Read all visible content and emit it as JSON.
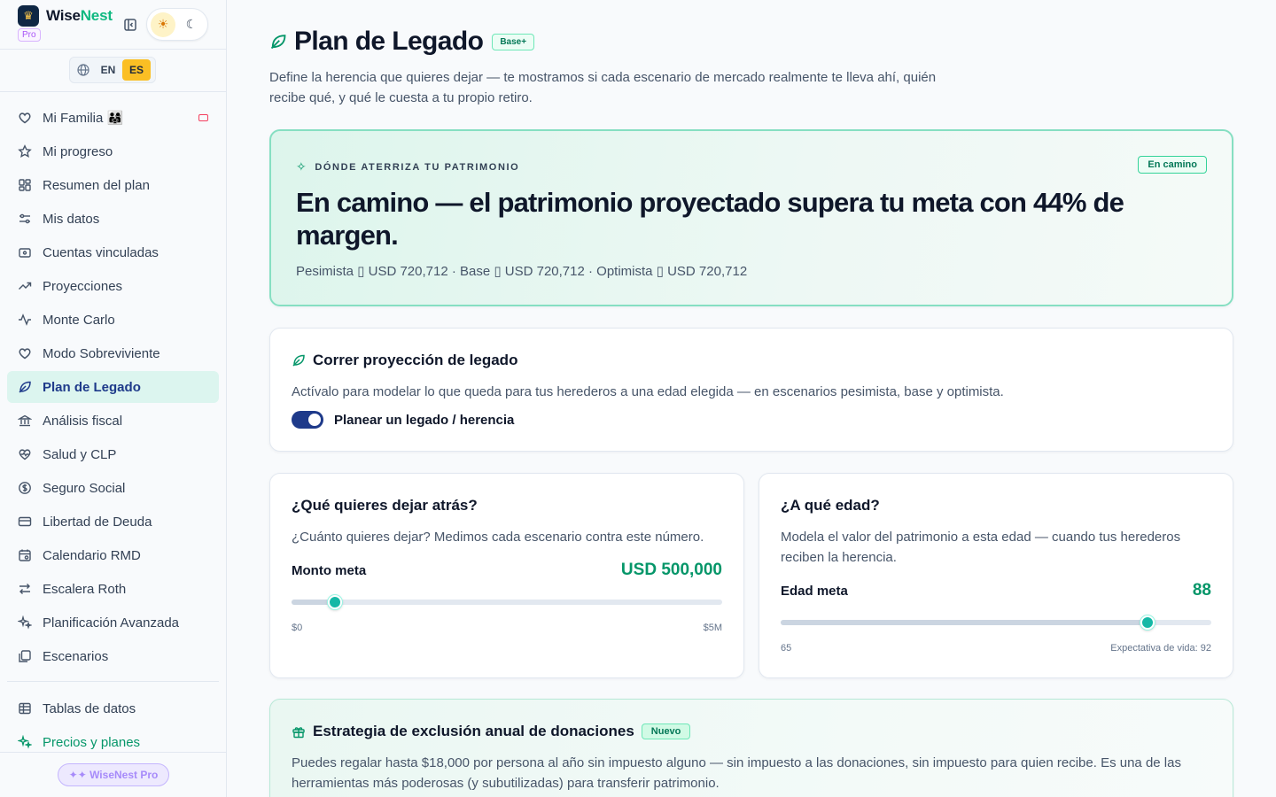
{
  "brand": {
    "name_part1": "Wise",
    "name_part2": "Nest",
    "tier": "Pro"
  },
  "language": {
    "options": [
      "EN",
      "ES"
    ],
    "active": "ES"
  },
  "sidebar": {
    "items": [
      {
        "label": "Mi Familia 👨‍👩‍👧",
        "icon": "heart-icon"
      },
      {
        "label": "Mi progreso",
        "icon": "star-icon"
      },
      {
        "label": "Resumen del plan",
        "icon": "grid-icon"
      },
      {
        "label": "Mis datos",
        "icon": "sliders-icon"
      },
      {
        "label": "Cuentas vinculadas",
        "icon": "wallet-icon"
      },
      {
        "label": "Proyecciones",
        "icon": "trend-icon"
      },
      {
        "label": "Monte Carlo",
        "icon": "pulse-icon"
      },
      {
        "label": "Modo Sobreviviente",
        "icon": "heart-icon"
      },
      {
        "label": "Plan de Legado",
        "icon": "leaf-icon"
      },
      {
        "label": "Análisis fiscal",
        "icon": "bank-icon"
      },
      {
        "label": "Salud y CLP",
        "icon": "heart-pulse-icon"
      },
      {
        "label": "Seguro Social",
        "icon": "dollar-icon"
      },
      {
        "label": "Libertad de Deuda",
        "icon": "card-icon"
      },
      {
        "label": "Calendario RMD",
        "icon": "calendar-icon"
      },
      {
        "label": "Escalera Roth",
        "icon": "arrows-icon"
      },
      {
        "label": "Planificación Avanzada",
        "icon": "sparkle-icon"
      },
      {
        "label": "Escenarios",
        "icon": "copy-icon"
      }
    ],
    "secondary": [
      {
        "label": "Tablas de datos",
        "icon": "table-icon"
      },
      {
        "label": "Precios y planes",
        "icon": "sparkle-icon"
      }
    ],
    "footer_cta": "✦✦ WiseNest Pro"
  },
  "page": {
    "title": "Plan de Legado",
    "badge": "Base+",
    "description": "Define la herencia que quieres dejar — te mostramos si cada escenario de mercado realmente te lleva ahí, quién recibe qué, y qué le cuesta a tu propio retiro."
  },
  "hero": {
    "eyebrow": "DÓNDE ATERRIZA TU PATRIMONIO",
    "status": "En camino",
    "headline": "En camino — el patrimonio proyectado supera tu meta con 44% de margen.",
    "scenarios": "Pesimista ▯ USD 720,712 · Base ▯ USD 720,712 · Optimista ▯ USD 720,712"
  },
  "run_card": {
    "title": "Correr proyección de legado",
    "description": "Actívalo para modelar lo que queda para tus herederos a una edad elegida — en escenarios pesimista, base y optimista.",
    "toggle_label": "Planear un legado / herencia",
    "toggle_on": true
  },
  "goal_card": {
    "title": "¿Qué quieres dejar atrás?",
    "description": "¿Cuánto quieres dejar? Medimos cada escenario contra este número.",
    "field_label": "Monto meta",
    "value_text": "USD 500,000",
    "slider": {
      "min": 0,
      "max": 5000000,
      "value": 500000
    },
    "min_label": "$0",
    "max_label": "$5M"
  },
  "age_card": {
    "title": "¿A qué edad?",
    "description": "Modela el valor del patrimonio a esta edad — cuando tus herederos reciben la herencia.",
    "field_label": "Edad meta",
    "value_text": "88",
    "slider": {
      "min": 65,
      "max": 92,
      "value": 88
    },
    "min_label": "65",
    "max_label": "Expectativa de vida: 92"
  },
  "gift_card": {
    "title": "Estrategia de exclusión anual de donaciones",
    "badge": "Nuevo",
    "description": "Puedes regalar hasta $18,000 por persona al año sin impuesto alguno — sin impuesto a las donaciones, sin impuesto para quien recibe. Es una de las herramientas más poderosas (y subutilizadas) para transferir patrimonio."
  },
  "colors": {
    "accent": "#059669",
    "nav_active_bg": "#dcf5ef",
    "primary": "#1e3a8a"
  }
}
